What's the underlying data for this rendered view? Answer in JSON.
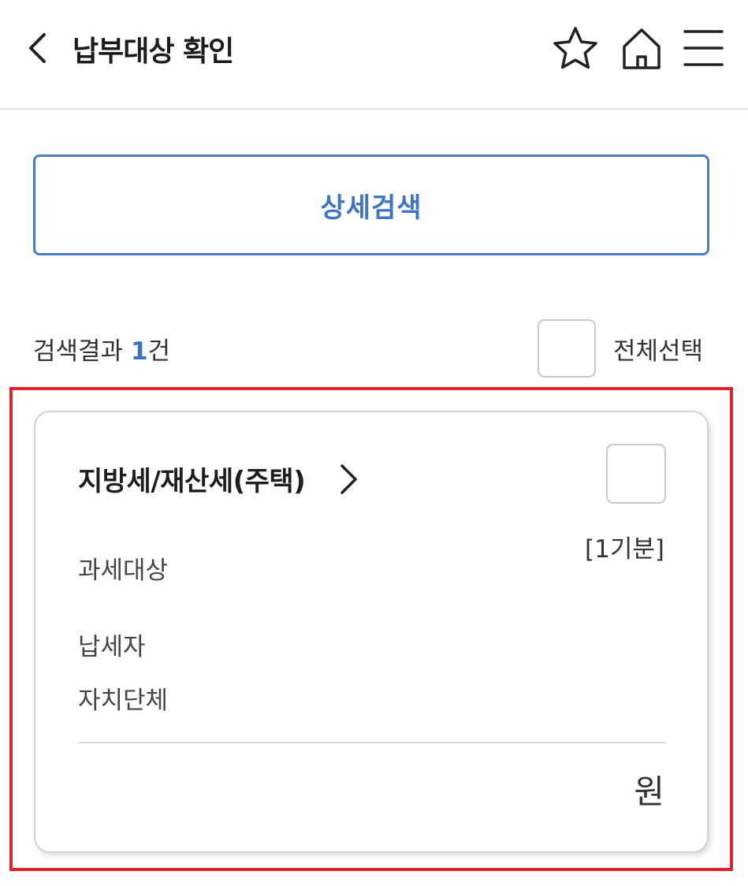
{
  "header": {
    "title": "납부대상 확인",
    "back_icon": "chevron-left-icon",
    "favorite_icon": "star-icon",
    "home_icon": "home-icon",
    "menu_icon": "hamburger-menu-icon"
  },
  "search": {
    "detail_button_label": "상세검색"
  },
  "results": {
    "prefix": "검색결과 ",
    "count": "1",
    "suffix": "건",
    "select_all_label": "전체선택",
    "select_all_checked": false
  },
  "items": [
    {
      "title": "지방세/재산세(주택)",
      "checked": false,
      "period": "[1기분]",
      "fields": [
        "과세대상",
        "납세자",
        "자치단체"
      ],
      "amount_unit": "원"
    }
  ],
  "colors": {
    "accent": "#3f74be",
    "highlight_frame": "#e0222c"
  }
}
